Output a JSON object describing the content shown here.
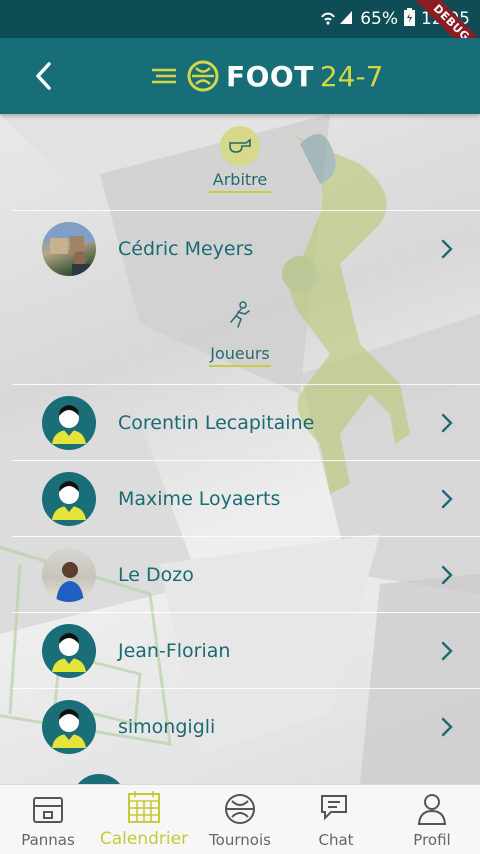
{
  "status_bar": {
    "signal": "☲ .❘",
    "battery": "65%",
    "time": "12:05",
    "debug_label": "DEBUG"
  },
  "app_bar": {
    "back_icon": "chevron-left-icon",
    "logo_text": "FOOT",
    "logo_number": "24-7"
  },
  "sections": {
    "referee": {
      "label": "Arbitre",
      "icon": "whistle-icon"
    },
    "players": {
      "label": "Joueurs",
      "icon": "running-player-icon"
    }
  },
  "referee_row": {
    "name": "Cédric Meyers",
    "avatar": "photo"
  },
  "players": [
    {
      "name": "Corentin Lecapitaine",
      "avatar": "generic"
    },
    {
      "name": "Maxime Loyaerts",
      "avatar": "generic"
    },
    {
      "name": "Le Dozo",
      "avatar": "photo"
    },
    {
      "name": "Jean-Florian",
      "avatar": "generic"
    },
    {
      "name": "simongigli",
      "avatar": "generic"
    }
  ],
  "bottom_nav": [
    {
      "label": "Pannas",
      "icon": "chest-icon",
      "active": false
    },
    {
      "label": "Calendrier",
      "icon": "calendar-icon",
      "active": true
    },
    {
      "label": "Tournois",
      "icon": "ball-icon",
      "active": false
    },
    {
      "label": "Chat",
      "icon": "chat-icon",
      "active": false
    },
    {
      "label": "Profil",
      "icon": "person-icon",
      "active": false
    }
  ],
  "colors": {
    "primary": "#176e78",
    "status_bar": "#0e4d55",
    "accent": "#c9cc3f",
    "text": "#1b6b74"
  }
}
